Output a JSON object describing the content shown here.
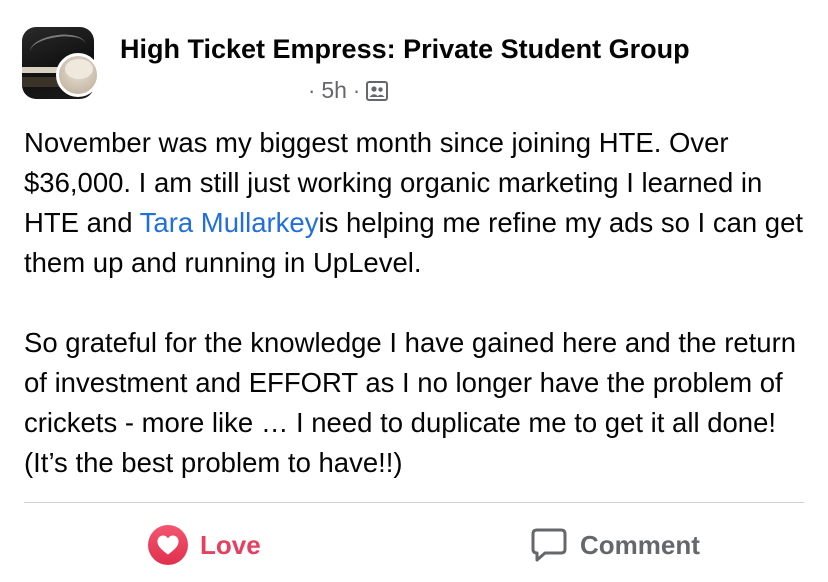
{
  "post": {
    "group_name": "High Ticket Empress: Private Student Group",
    "meta": {
      "separator": "·",
      "time": "5h",
      "audience_icon": "group-members-icon"
    },
    "body": {
      "paragraph1": {
        "before_mention": "November was my biggest month since joining HTE. Over $36,000. I am still just working organic marketing I learned in HTE and ",
        "mention": "Tara Mullarkey",
        "after_mention": "is helping me refine my ads so I can get them up and running in UpLevel."
      },
      "paragraph2": "So grateful for the knowledge I have gained here and the return of investment and EFFORT as I no longer have the problem of crickets - more like … I need to duplicate me to get it all done! (It’s the best problem to have!!)"
    },
    "actions": {
      "love_label": "Love",
      "comment_label": "Comment"
    },
    "colors": {
      "mention": "#216fdb",
      "love": "#e4405f",
      "secondary_text": "#65676b",
      "divider": "#ced0d4"
    }
  }
}
